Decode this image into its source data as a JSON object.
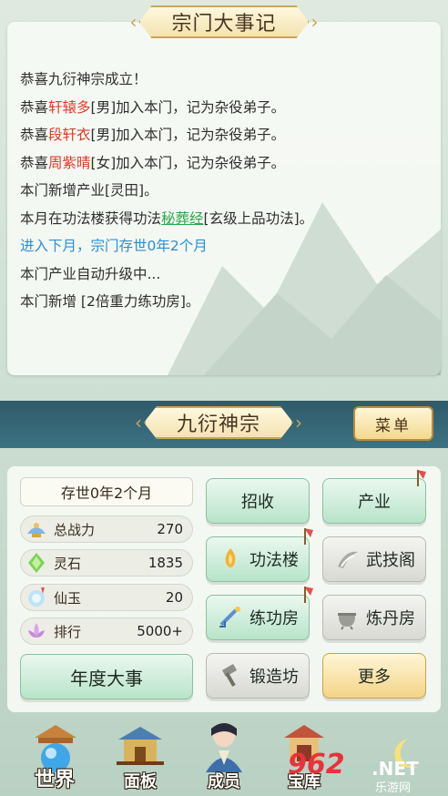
{
  "log": {
    "title": "宗门大事记",
    "lines": [
      {
        "parts": [
          {
            "t": "恭喜九衍神宗成立！",
            "c": ""
          }
        ]
      },
      {
        "parts": [
          {
            "t": "恭喜",
            "c": ""
          },
          {
            "t": "轩辕多",
            "c": "red"
          },
          {
            "t": "[男]加入本门，记为杂役弟子。",
            "c": ""
          }
        ]
      },
      {
        "parts": [
          {
            "t": "恭喜",
            "c": ""
          },
          {
            "t": "段轩衣",
            "c": "red"
          },
          {
            "t": "[男]加入本门，记为杂役弟子。",
            "c": ""
          }
        ]
      },
      {
        "parts": [
          {
            "t": "恭喜",
            "c": ""
          },
          {
            "t": "周紫晴",
            "c": "red"
          },
          {
            "t": "[女]加入本门，记为杂役弟子。",
            "c": ""
          }
        ]
      },
      {
        "parts": [
          {
            "t": "本门新增产业[灵田]。",
            "c": ""
          }
        ]
      },
      {
        "parts": [
          {
            "t": "本月在功法楼获得功法",
            "c": ""
          },
          {
            "t": "秘葬经",
            "c": "green"
          },
          {
            "t": "[玄级上品功法]。",
            "c": ""
          }
        ]
      },
      {
        "parts": [
          {
            "t": "进入下月，宗门存世0年2个月",
            "c": "blue"
          }
        ]
      },
      {
        "parts": [
          {
            "t": "本门产业自动升级中...",
            "c": ""
          }
        ]
      },
      {
        "parts": [
          {
            "t": "本门新增 [2倍重力练功房]。",
            "c": ""
          }
        ]
      }
    ]
  },
  "sect": {
    "name": "九衍神宗",
    "menu_label": "菜单",
    "age": "存世0年2个月",
    "stats": [
      {
        "label": "总战力",
        "value": "270",
        "icon": "power-icon"
      },
      {
        "label": "灵石",
        "value": "1835",
        "icon": "spirit-stone-icon"
      },
      {
        "label": "仙玉",
        "value": "20",
        "icon": "jade-icon"
      },
      {
        "label": "排行",
        "value": "5000+",
        "icon": "lotus-icon"
      }
    ],
    "annual_events": "年度大事"
  },
  "buttons": {
    "recruit": "招收",
    "industry": "产业",
    "skill_tower": "功法楼",
    "martial_pavilion": "武技阁",
    "training_room": "练功房",
    "alchemy_room": "炼丹房",
    "forge": "锻造坊",
    "more": "更多"
  },
  "nav": {
    "world": "世界",
    "panel": "面板",
    "members": "成员",
    "treasury": "宝库"
  },
  "watermark": {
    "logo": "962",
    "net": ".NET",
    "cn": "乐游网"
  },
  "colors": {
    "name_red": "#e0392b",
    "skill_green": "#2aa84a",
    "info_blue": "#2a8fd6",
    "band": "#2f5a6a"
  }
}
